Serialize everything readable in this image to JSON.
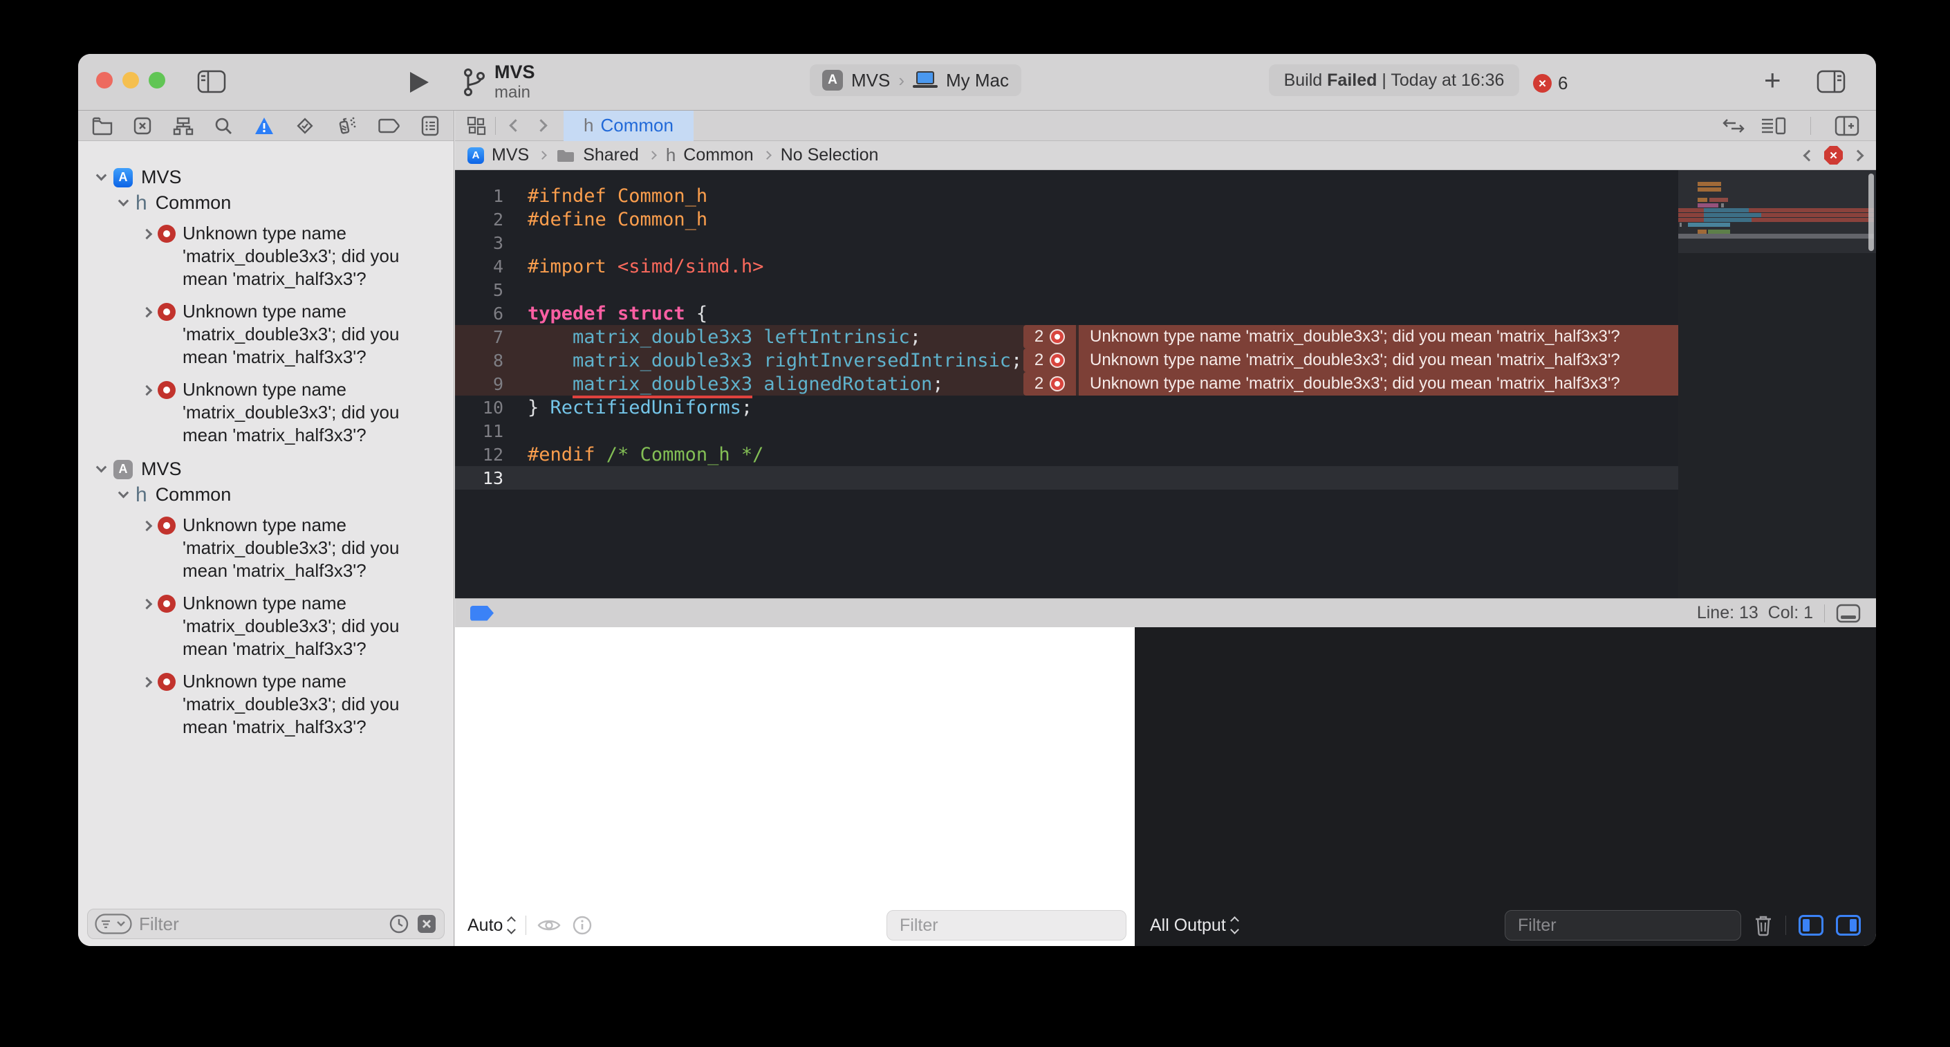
{
  "toolbar": {
    "project": "MVS",
    "branch": "main",
    "scheme": {
      "target": "MVS",
      "destination": "My Mac"
    },
    "status": {
      "prefix": "Build",
      "result": "Failed",
      "detail": "| Today at 16:36"
    },
    "errors": {
      "count": "6"
    },
    "plus_label": "+"
  },
  "navigator": {
    "groups": [
      {
        "project": "MVS",
        "file": "Common",
        "file_type": "h",
        "issues": [
          "Unknown type name 'matrix_double3x3'; did you mean 'matrix_half3x3'?",
          "Unknown type name 'matrix_double3x3'; did you mean 'matrix_half3x3'?",
          "Unknown type name 'matrix_double3x3'; did you mean 'matrix_half3x3'?"
        ]
      },
      {
        "project": "MVS",
        "file": "Common",
        "file_type": "h",
        "issues": [
          "Unknown type name 'matrix_double3x3'; did you mean 'matrix_half3x3'?",
          "Unknown type name 'matrix_double3x3'; did you mean 'matrix_half3x3'?",
          "Unknown type name 'matrix_double3x3'; did you mean 'matrix_half3x3'?"
        ]
      }
    ],
    "filter": {
      "placeholder": "Filter"
    }
  },
  "editor": {
    "tab": {
      "file_type": "h",
      "title": "Common"
    },
    "breadcrumbs": {
      "project": "MVS",
      "group": "Shared",
      "file_type": "h",
      "file": "Common",
      "selection": "No Selection"
    },
    "lines": [
      {
        "num": "1",
        "segs": [
          [
            "pre",
            "#ifndef Common_h"
          ]
        ]
      },
      {
        "num": "2",
        "segs": [
          [
            "pre",
            "#define Common_h"
          ]
        ]
      },
      {
        "num": "3",
        "segs": []
      },
      {
        "num": "4",
        "segs": [
          [
            "pre",
            "#import "
          ],
          [
            "str",
            "<simd/simd.h>"
          ]
        ]
      },
      {
        "num": "5",
        "segs": []
      },
      {
        "num": "6",
        "segs": [
          [
            "kw",
            "typedef struct"
          ],
          [
            "plain",
            " {"
          ]
        ]
      },
      {
        "num": "7",
        "err": true,
        "segs": [
          [
            "plain",
            "    "
          ],
          [
            "typu",
            "matrix_double3x3"
          ],
          [
            "typ",
            " leftIntrinsic"
          ],
          [
            "plain",
            ";"
          ]
        ]
      },
      {
        "num": "8",
        "err": true,
        "segs": [
          [
            "plain",
            "    "
          ],
          [
            "typu",
            "matrix_double3x3"
          ],
          [
            "typ",
            " rightInversedIntrinsic"
          ],
          [
            "plain",
            ";"
          ]
        ]
      },
      {
        "num": "9",
        "err": true,
        "segs": [
          [
            "plain",
            "    "
          ],
          [
            "typu",
            "matrix_double3x3"
          ],
          [
            "typ",
            " alignedRotation"
          ],
          [
            "plain",
            ";"
          ]
        ]
      },
      {
        "num": "10",
        "segs": [
          [
            "plain",
            "} "
          ],
          [
            "tdecl",
            "RectifiedUniforms"
          ],
          [
            "plain",
            ";"
          ]
        ]
      },
      {
        "num": "11",
        "segs": []
      },
      {
        "num": "12",
        "segs": [
          [
            "pre",
            "#endif"
          ],
          [
            "cmt",
            " /* Common_h */"
          ]
        ]
      },
      {
        "num": "13",
        "current": true,
        "segs": []
      }
    ],
    "inline_error": {
      "count": "2",
      "message": "Unknown type name 'matrix_double3x3'; did you mean 'matrix_half3x3'?"
    },
    "status_bar": {
      "line_col": "Line: 13  Col: 1"
    }
  },
  "debug": {
    "variables": {
      "scope": "Auto",
      "filter_placeholder": "Filter"
    },
    "console": {
      "scope": "All Output",
      "filter_placeholder": "Filter"
    }
  }
}
